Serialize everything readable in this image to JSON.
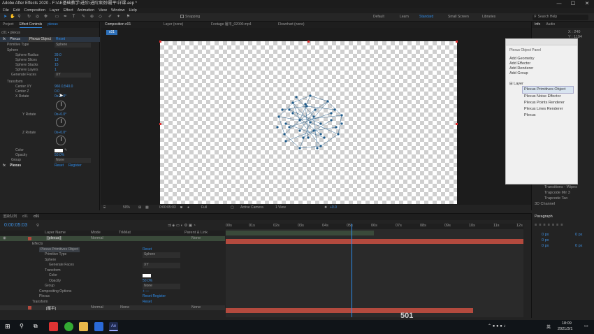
{
  "titlebar": {
    "title": "Adobe After Effects 2020 - F:\\AE基础教学\\进阶\\进阶案例\\履平\\详课.aep *",
    "win_min": "—",
    "win_max": "☐",
    "win_close": "✕"
  },
  "menu": [
    "File",
    "Edit",
    "Composition",
    "Layer",
    "Effect",
    "Animation",
    "View",
    "Window",
    "Help"
  ],
  "toolbar": {
    "snapping": "Snapping",
    "workspaces": [
      "Default",
      "Learn",
      "Standard",
      "Small Screen",
      "Libraries"
    ],
    "search_placeholder": "Search Help"
  },
  "project_panel": {
    "tabs": [
      "Project",
      "Effect Controls",
      "plexus"
    ],
    "breadcrumb": "c01 • plexus"
  },
  "effect_controls": {
    "effect_name": "Plexus",
    "effect_tab": "Plexus Object",
    "reset": "Reset",
    "primitive_type_label": "Primitive Type",
    "primitive_type_value": "Sphere",
    "sphere_label": "Sphere",
    "sphere_radius_label": "Sphere Radius",
    "sphere_radius_value": "39.0",
    "sphere_slices_label": "Sphere Slices",
    "sphere_slices_value": "13",
    "sphere_stacks_label": "Sphere Stacks",
    "sphere_stacks_value": "15",
    "sphere_layers_label": "Sphere Layers",
    "sphere_layers_value": "1",
    "generate_faces_label": "Generate Faces",
    "generate_faces_value": "XY",
    "transform_label": "Transform",
    "center_xy_label": "Center XY",
    "center_xy_value": "960.0,540.0",
    "center_z_label": "Center Z",
    "center_z_value": "0.0",
    "x_rotate_label": "X Rotate",
    "x_rotate_value": "0x+0.0°",
    "y_rotate_label": "Y Rotate",
    "y_rotate_value": "0x+0.0°",
    "z_rotate_label": "Z Rotate",
    "z_rotate_value": "0x+0.0°",
    "color_label": "Color",
    "opacity_label": "Opacity",
    "opacity_value": "50.0%",
    "group_label": "Group",
    "group_value": "None",
    "plexus_label": "Plexus",
    "reset2": "Reset",
    "register": "Register"
  },
  "viewer": {
    "comp_tab": "Composition c01",
    "layer_tab": "Layer (none)",
    "footage_tab": "Footage 履平_02000.mp4",
    "flowchart_tab": "Flowchart (none)",
    "sub_tab": "c01",
    "footer": {
      "zoom": "50%",
      "time": "0:00:05:03",
      "resolution": "Full",
      "camera": "Active Camera",
      "view": "1 View",
      "exposure": "+0.0"
    }
  },
  "plexus_panel": {
    "title": "Plexus Object Panel",
    "buttons": [
      "Add Geometry",
      "Add Effector",
      "Add Renderer",
      "Add Group"
    ],
    "layer_label": "Layer",
    "tree": [
      "Plexus Primitives Object",
      "Plexus Noise Effector",
      "Plexus Points Renderer",
      "Plexus Lines Renderer",
      "Plexus"
    ]
  },
  "right_panel": {
    "tabs": [
      "Info",
      "Audio"
    ],
    "x_readout": "X : 240",
    "y_readout": "Y : 1194",
    "lib_items": [
      "Transitions - Wipes",
      "Trapcode Mir 3",
      "Trapcode Tao",
      "3D Channel"
    ],
    "paragraph_title": "Paragraph",
    "px_values": [
      "0 px",
      "0 px",
      "0 px",
      "0 px",
      "0 px"
    ]
  },
  "timeline": {
    "tabs": [
      "渲染队列",
      "c01",
      "c01"
    ],
    "timecode": "0:00:05:03",
    "col_headers": {
      "layer_name": "Layer Name",
      "mode": "Mode",
      "trkmat": "TrkMat",
      "parent": "Parent & Link"
    },
    "layer1_name": "[plexus]",
    "layer1_mode": "Normal",
    "layer1_parent": "None",
    "rows": [
      {
        "label": "Effects",
        "value": ""
      },
      {
        "label": "Plexus Primitives Object",
        "value": "Reset"
      },
      {
        "label": "Primitive Type",
        "value": "Sphere"
      },
      {
        "label": "Sphere",
        "value": ""
      },
      {
        "label": "Generate Faces",
        "value": "XY"
      },
      {
        "label": "Transform",
        "value": ""
      },
      {
        "label": "Color",
        "value": ""
      },
      {
        "label": "Opacity",
        "value": "50.0%"
      },
      {
        "label": "Group",
        "value": "None"
      },
      {
        "label": "Compositing Options",
        "value": "+ —"
      },
      {
        "label": "Plexus",
        "value": "Reset   Register"
      },
      {
        "label": "Transform",
        "value": "Reset"
      }
    ],
    "layer2_name": "[履平]",
    "layer2_mode": "Normal",
    "layer2_trk": "None",
    "layer2_parent": "None",
    "ruler": [
      "00s",
      "01s",
      "02s",
      "03s",
      "04s",
      "05s",
      "06s",
      "07s",
      "08s",
      "09s",
      "10s",
      "11s",
      "12s"
    ],
    "frame_readout": "501"
  },
  "taskbar": {
    "time": "18:09",
    "date": "2021/3/1",
    "ime": "英"
  },
  "colors": {
    "accent": "#2d8ceb",
    "work_bar": "#b34a3e",
    "panel": "#232323",
    "plexus_dots": "#1d5a8a"
  }
}
